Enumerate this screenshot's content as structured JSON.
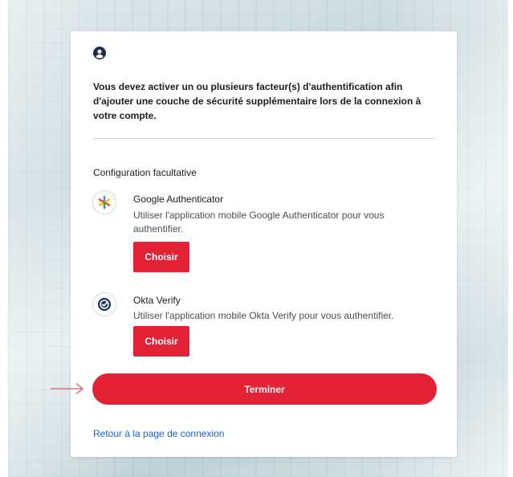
{
  "intro": {
    "message": "Vous devez activer un ou plusieurs facteur(s) d'authentification afin d'ajouter une couche de sécurité supplémentaire lors de la connexion à votre compte."
  },
  "optional": {
    "title": "Configuration facultative",
    "factors": [
      {
        "name": "Google Authenticator",
        "description": "Utiliser l'application mobile Google Authenticator pour vous authentifier.",
        "button": "Choisir",
        "icon": "google-authenticator-icon"
      },
      {
        "name": "Okta Verify",
        "description": "Utiliser l'application mobile Okta Verify pour vous authentifier.",
        "button": "Choisir",
        "icon": "okta-verify-icon"
      }
    ]
  },
  "actions": {
    "finish": "Terminer",
    "back": "Retour à la page de connexion"
  },
  "colors": {
    "primary": "#e32236",
    "link": "#1662dd",
    "icon": "#1a2d4f",
    "annotation_arrow": "#e8707e"
  }
}
